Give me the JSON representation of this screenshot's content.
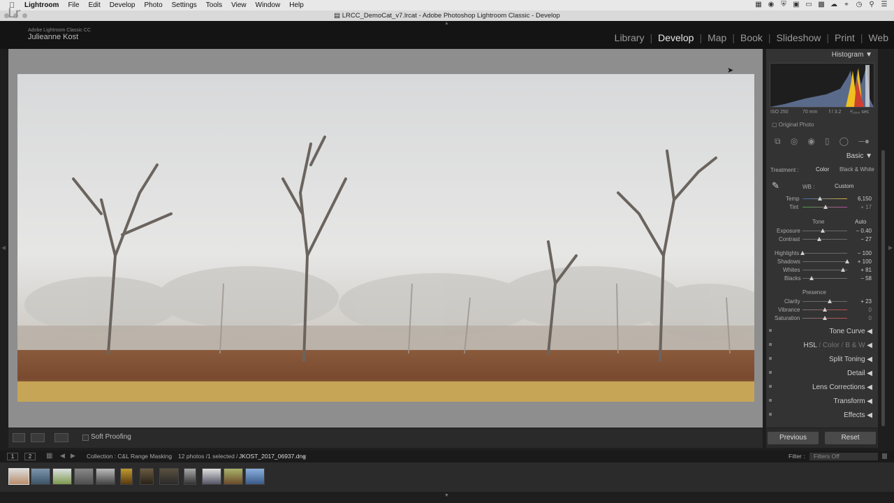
{
  "menubar": {
    "app": "Lightroom",
    "items": [
      "File",
      "Edit",
      "Develop",
      "Photo",
      "Settings",
      "Tools",
      "View",
      "Window",
      "Help"
    ]
  },
  "window_title": "LRCC_DemoCat_v7.lrcat - Adobe Photoshop Lightroom Classic - Develop",
  "identity": {
    "logo": "Lr",
    "app_name": "Adobe Lightroom Classic CC",
    "user": "Julieanne Kost"
  },
  "modules": [
    "Library",
    "Develop",
    "Map",
    "Book",
    "Slideshow",
    "Print",
    "Web"
  ],
  "active_module": "Develop",
  "toolbar": {
    "soft_proofing": "Soft Proofing"
  },
  "right_panel": {
    "histogram_title": "Histogram",
    "meta": {
      "iso": "ISO 250",
      "focal": "70 mm",
      "aperture": "f / 3.2",
      "shutter": "¹⁄₁₆₀₀ sec"
    },
    "original_photo": "Original Photo",
    "basic_title": "Basic",
    "treatment_label": "Treatment :",
    "treatment_color": "Color",
    "treatment_bw": "Black & White",
    "wb_label": "WB :",
    "wb_value": "Custom",
    "temp": {
      "label": "Temp",
      "value": "6,150",
      "pos": 0.39
    },
    "tint": {
      "label": "Tint",
      "value": "+ 17",
      "pos": 0.52
    },
    "tone_title": "Tone",
    "tone_auto": "Auto",
    "exposure": {
      "label": "Exposure",
      "value": "− 0.40",
      "pos": 0.46
    },
    "contrast": {
      "label": "Contrast",
      "value": "− 27",
      "pos": 0.37
    },
    "highlights": {
      "label": "Highlights",
      "value": "− 100",
      "pos": 0.0
    },
    "shadows": {
      "label": "Shadows",
      "value": "+ 100",
      "pos": 1.0
    },
    "whites": {
      "label": "Whites",
      "value": "+ 81",
      "pos": 0.9
    },
    "blacks": {
      "label": "Blacks",
      "value": "− 58",
      "pos": 0.21
    },
    "presence_title": "Presence",
    "clarity": {
      "label": "Clarity",
      "value": "+ 23",
      "pos": 0.61
    },
    "vibrance": {
      "label": "Vibrance",
      "value": "0",
      "pos": 0.5
    },
    "saturation": {
      "label": "Saturation",
      "value": "0",
      "pos": 0.5
    },
    "sections": [
      "Tone Curve",
      "Split Toning",
      "Detail",
      "Lens Corrections",
      "Transform",
      "Effects"
    ],
    "hsl": {
      "hsl": "HSL",
      "color": "Color",
      "bw": "B & W"
    },
    "previous": "Previous",
    "reset": "Reset"
  },
  "filmbar": {
    "page1": "1",
    "page2": "2",
    "collection": "Collection : C&L Range Masking",
    "count": "12 photos /1 selected /",
    "filename": "JKOST_2017_06937.dng",
    "filter_label": "Filter :",
    "filter_value": "Filters Off"
  },
  "colors": {
    "panel": "#333333",
    "accent_histogram": "#f0c020"
  }
}
